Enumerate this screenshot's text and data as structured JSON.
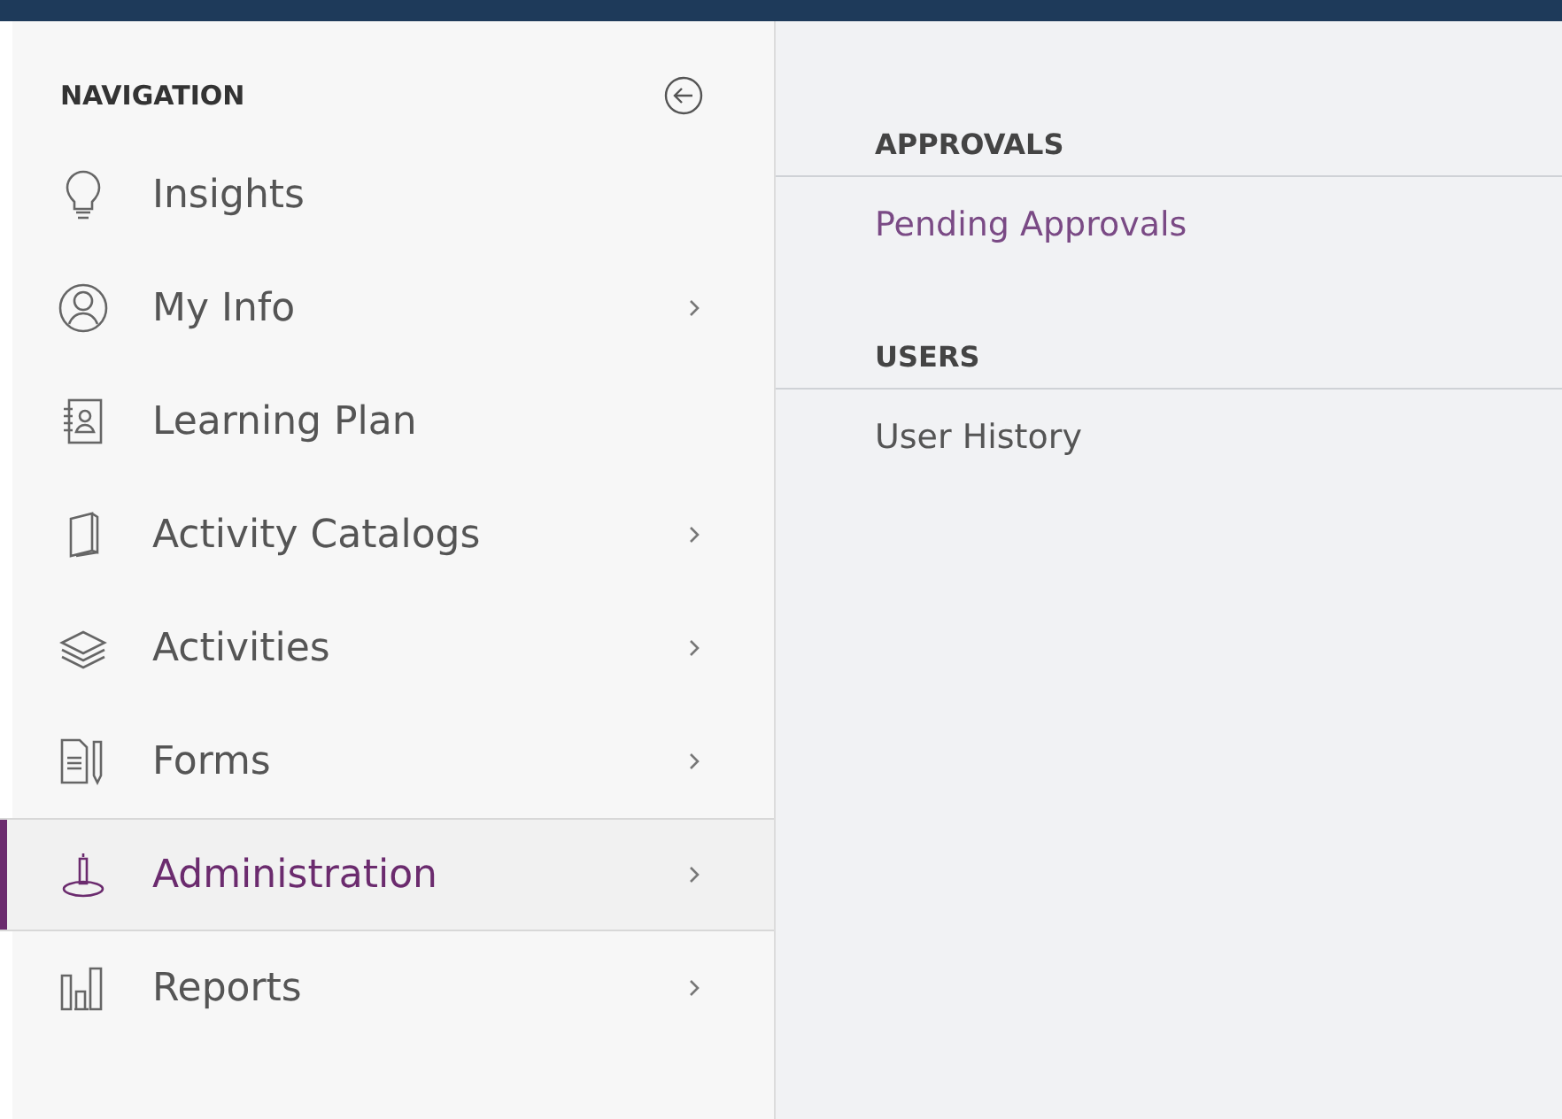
{
  "sidebar": {
    "title": "NAVIGATION",
    "items": [
      {
        "kind": "bulb",
        "label": "Insights",
        "has_submenu": false,
        "selected": false
      },
      {
        "kind": "person",
        "label": "My Info",
        "has_submenu": true,
        "selected": false
      },
      {
        "kind": "contacts",
        "label": "Learning Plan",
        "has_submenu": false,
        "selected": false
      },
      {
        "kind": "book",
        "label": "Activity Catalogs",
        "has_submenu": true,
        "selected": false
      },
      {
        "kind": "layers",
        "label": "Activities",
        "has_submenu": true,
        "selected": false
      },
      {
        "kind": "form",
        "label": "Forms",
        "has_submenu": true,
        "selected": false
      },
      {
        "kind": "pin",
        "label": "Administration",
        "has_submenu": true,
        "selected": true
      },
      {
        "kind": "bars",
        "label": "Reports",
        "has_submenu": true,
        "selected": false
      }
    ]
  },
  "submenu": {
    "sections": [
      {
        "heading": "APPROVALS",
        "links": [
          {
            "label": "Pending Approvals",
            "selected": true
          }
        ]
      },
      {
        "heading": "USERS",
        "links": [
          {
            "label": "User History",
            "selected": false
          }
        ]
      }
    ]
  }
}
